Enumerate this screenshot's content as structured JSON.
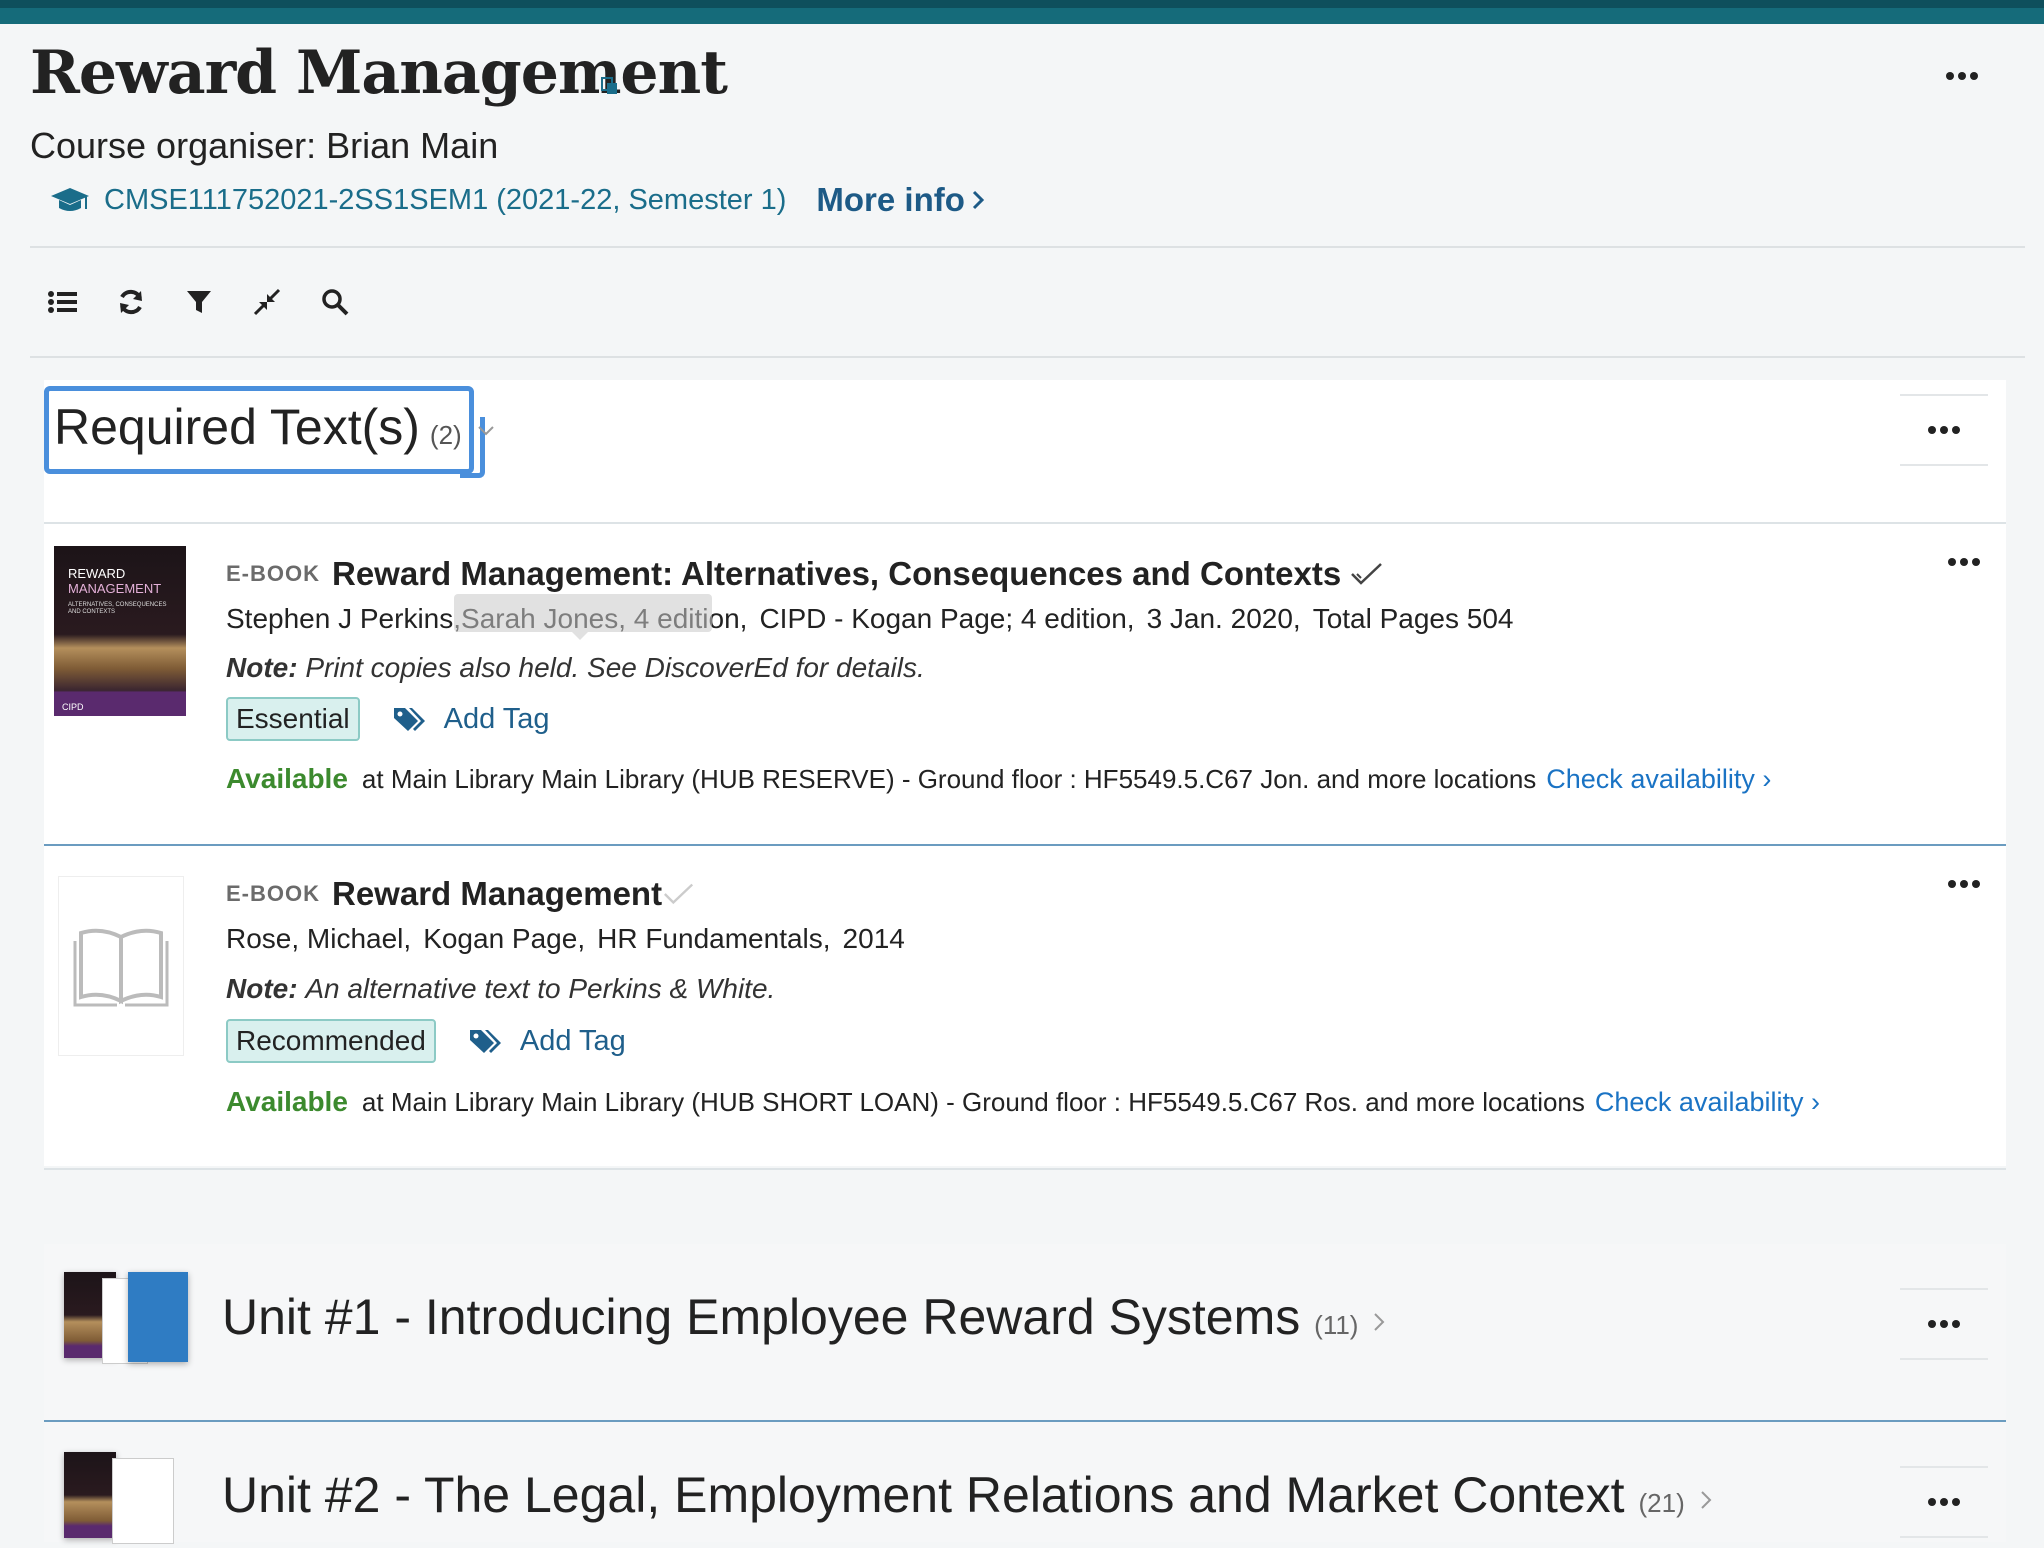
{
  "header": {
    "title": "Reward Management",
    "organiser": "Course organiser: Brian Main",
    "course_code": "CMSE111752021-2SS1SEM1 (2021-22, Semester 1)",
    "more_info": "More info"
  },
  "toolbar": {
    "icons": [
      "list-icon",
      "refresh-icon",
      "filter-icon",
      "collapse-icon",
      "search-icon"
    ]
  },
  "required_section": {
    "title": "Required Text(s)",
    "count": "(2)",
    "items": [
      {
        "type": "E-BOOK",
        "title": "Reward Management: Alternatives, Consequences and Contexts",
        "authors": "Stephen J Perkins,Sarah Jones, 4 edition,",
        "publisher": "CIPD - Kogan Page; 4 edition,",
        "date": "3 Jan. 2020,",
        "pages": "Total Pages 504",
        "note_label": "Note:",
        "note_text": "Print copies also held. See DiscoverEd for details.",
        "tag": "Essential",
        "add_tag": "Add Tag",
        "availability_status": "Available",
        "availability_text": "at Main Library Main Library (HUB RESERVE) - Ground floor : HF5549.5.C67 Jon. and more locations",
        "check": "Check availability",
        "cover": {
          "line1": "REWARD",
          "line2": "MANAGEMENT",
          "line3": "ALTERNATIVES, CONSEQUENCES AND CONTEXTS",
          "publisher": "CIPD"
        }
      },
      {
        "type": "E-BOOK",
        "title": "Reward Management",
        "authors": "Rose, Michael,",
        "publisher": "Kogan Page,",
        "series": "HR Fundamentals,",
        "year": "2014",
        "note_label": "Note:",
        "note_text": "An alternative text to Perkins & White.",
        "tag": "Recommended",
        "add_tag": "Add Tag",
        "availability_status": "Available",
        "availability_text": "at Main Library Main Library (HUB SHORT LOAN) - Ground floor : HF5549.5.C67 Ros. and more locations",
        "check": "Check availability"
      }
    ]
  },
  "units": [
    {
      "title": "Unit #1 - Introducing Employee Reward Systems",
      "count": "(11)"
    },
    {
      "title": "Unit #2 - The Legal, Employment Relations and Market Context",
      "count": "(21)"
    }
  ],
  "colors": {
    "topbar": "#156b7a",
    "link": "#1a6d8a",
    "available": "#3c8a2e",
    "focus": "#4a8fdc",
    "tag_bg": "#d9f0ee"
  }
}
